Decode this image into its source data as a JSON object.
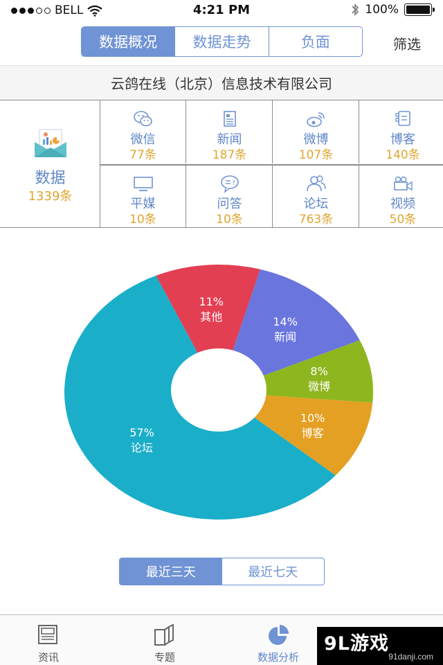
{
  "status_bar": {
    "carrier": "BELL",
    "time": "4:21 PM",
    "battery": "100%"
  },
  "top_tabs": [
    {
      "label": "数据概况",
      "active": true
    },
    {
      "label": "数据走势",
      "active": false
    },
    {
      "label": "负面",
      "active": false
    }
  ],
  "filter_label": "筛选",
  "company": "云鸽在线（北京）信息技术有限公司",
  "summary": {
    "label": "数据",
    "count": "1339条",
    "icon": "mail-chart-icon"
  },
  "sources": [
    {
      "label": "微信",
      "count": "77条",
      "icon": "wechat-icon"
    },
    {
      "label": "新闻",
      "count": "187条",
      "icon": "news-icon"
    },
    {
      "label": "微博",
      "count": "107条",
      "icon": "weibo-icon"
    },
    {
      "label": "博客",
      "count": "140条",
      "icon": "blog-icon"
    },
    {
      "label": "平媒",
      "count": "10条",
      "icon": "monitor-icon"
    },
    {
      "label": "问答",
      "count": "10条",
      "icon": "qa-icon"
    },
    {
      "label": "论坛",
      "count": "763条",
      "icon": "forum-icon"
    },
    {
      "label": "视频",
      "count": "50条",
      "icon": "video-icon"
    }
  ],
  "chart_data": {
    "type": "pie",
    "donut": true,
    "slices": [
      {
        "name": "其他",
        "percent_label": "11%",
        "value": 11,
        "color": "#e23f53"
      },
      {
        "name": "新闻",
        "percent_label": "14%",
        "value": 14,
        "color": "#6a76dd"
      },
      {
        "name": "微博",
        "percent_label": "8%",
        "value": 8,
        "color": "#8eb61f"
      },
      {
        "name": "博客",
        "percent_label": "10%",
        "value": 10,
        "color": "#e4a022"
      },
      {
        "name": "论坛",
        "percent_label": "57%",
        "value": 57,
        "color": "#1aaec9"
      }
    ]
  },
  "range_toggle": [
    {
      "label": "最近三天",
      "active": true
    },
    {
      "label": "最近七天",
      "active": false
    }
  ],
  "bottom_tabs": [
    {
      "label": "资讯",
      "icon": "news-tab-icon",
      "active": false
    },
    {
      "label": "专题",
      "icon": "topics-tab-icon",
      "active": false
    },
    {
      "label": "数据分析",
      "icon": "pie-tab-icon",
      "active": true
    }
  ],
  "watermark": {
    "main": "9L游戏",
    "sub": "91danji.com"
  },
  "colors": {
    "accent": "#6f93d4",
    "count": "#e0a52e",
    "label": "#5f86c9"
  }
}
